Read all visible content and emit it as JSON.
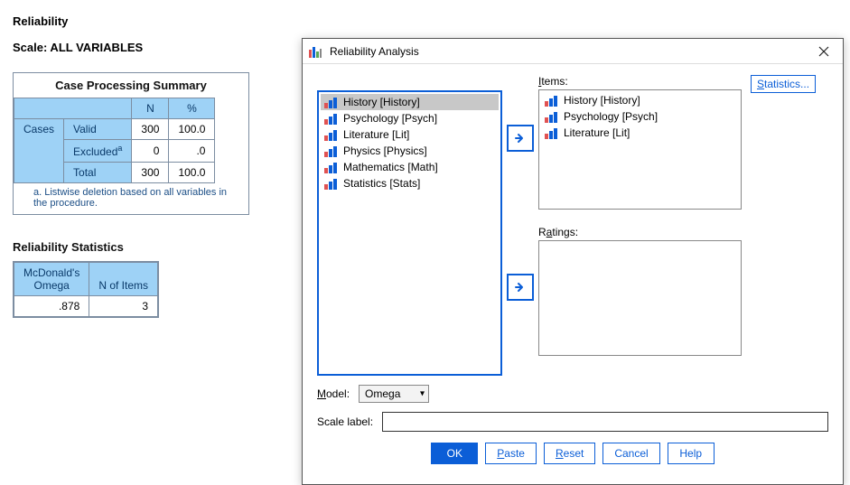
{
  "output": {
    "heading": "Reliability",
    "scale_line": "Scale: ALL VARIABLES",
    "case_summary": {
      "title": "Case Processing Summary",
      "col_n": "N",
      "col_pct": "%",
      "row_group": "Cases",
      "rows": [
        {
          "label": "Valid",
          "n": "300",
          "pct": "100.0"
        },
        {
          "label_html": "Excludedª",
          "label": "Excluded",
          "sup": "a",
          "n": "0",
          "pct": ".0"
        },
        {
          "label": "Total",
          "n": "300",
          "pct": "100.0"
        }
      ],
      "footnote": "a. Listwise deletion based on all variables in the procedure."
    },
    "rel_stats": {
      "title": "Reliability Statistics",
      "col_omega_l1": "McDonald's",
      "col_omega_l2": "Omega",
      "col_nitems": "N of Items",
      "omega": ".878",
      "nitems": "3"
    }
  },
  "dialog": {
    "title": "Reliability Analysis",
    "source_vars": [
      "History [History]",
      "Psychology [Psych]",
      "Literature [Lit]",
      "Physics [Physics]",
      "Mathematics [Math]",
      "Statistics [Stats]"
    ],
    "items_label": "Items:",
    "items": [
      "History [History]",
      "Psychology [Psych]",
      "Literature [Lit]"
    ],
    "ratings_label": "Ratings:",
    "statistics_btn": "Statistics...",
    "model_label": "Model:",
    "model_selected": "Omega",
    "scale_label": "Scale label:",
    "scale_value": "",
    "buttons": {
      "ok": "OK",
      "paste": "Paste",
      "reset": "Reset",
      "cancel": "Cancel",
      "help": "Help"
    }
  }
}
